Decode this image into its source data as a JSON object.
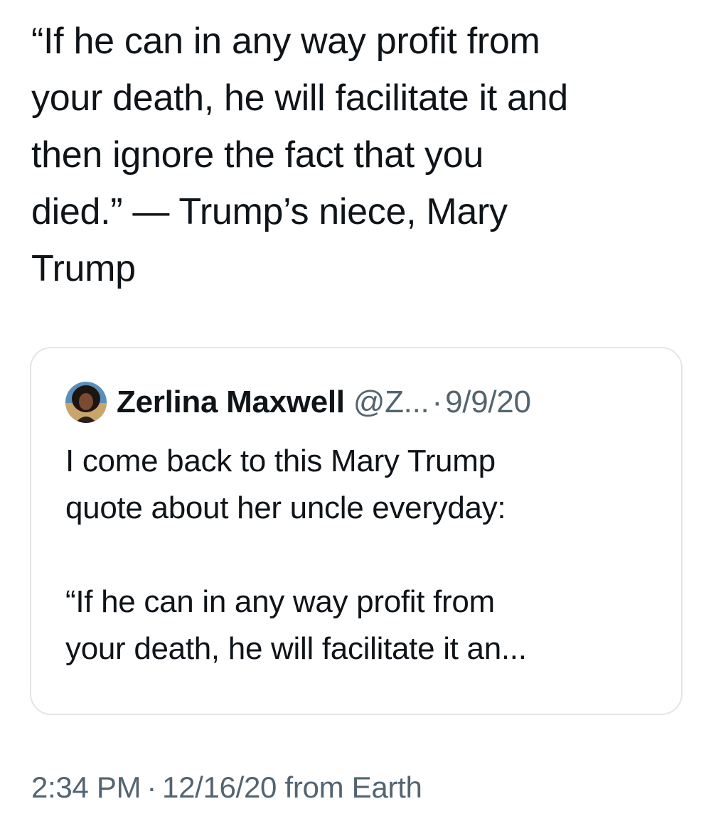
{
  "tweet": {
    "text": "“If he can in any way profit from\nyour death, he will facilitate it and\nthen ignore the fact that you\ndied.” — Trump’s niece, Mary\nTrump",
    "time": "2:34 PM",
    "separator": "·",
    "date": "12/16/20",
    "source": "from Earth"
  },
  "quoted_tweet": {
    "author_name": "Zerlina Maxwell",
    "author_handle": "@Z...",
    "separator": "·",
    "date": "9/9/20",
    "body_line_1": "I come back to this Mary Trump\nquote about her uncle everyday:",
    "body_line_2": "“If he can in any way profit from\nyour death, he will facilitate it an..."
  },
  "colors": {
    "text_primary": "#0f1419",
    "text_secondary": "#536471",
    "card_border": "#e3e6e9"
  },
  "icons": {
    "avatar": "user-avatar-photo"
  }
}
